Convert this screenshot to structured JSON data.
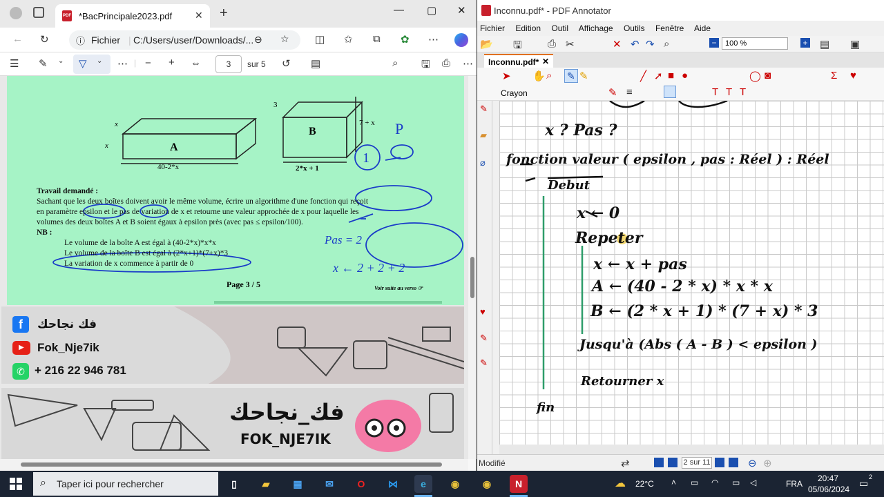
{
  "edge": {
    "tab_title": "*BacPrincipale2023.pdf",
    "tab_close": "✕",
    "new_tab": "+",
    "win_min": "—",
    "win_max": "▢",
    "win_close": "✕",
    "address_label": "Fichier",
    "address_url": "C:/Users/user/Downloads/...",
    "pdf_page": "3",
    "pdf_page_total": "sur 5",
    "document": {
      "box_a_label": "A",
      "box_b_label": "B",
      "box_a_dim": "40-2*x",
      "box_a_x1": "x",
      "box_a_x2": "x",
      "box_b_3": "3",
      "box_b_dim": "2*x + 1",
      "box_b_height": "7 + x",
      "task_title": "Travail demandé :",
      "task_line1": "Sachant que les deux boîtes doivent avoir le même volume, écrire un algorithme d'une fonction qui reçoit",
      "task_line2": "en paramètre epsilon et le pas de variation de x et retourne une valeur approchée de x pour laquelle les",
      "task_line3": "volumes des deux boîtes A et B soient égaux à epsilon près (avec pas ≤ epsilon/100).",
      "nb": "NB :",
      "bullet1": "Le volume de la boîte A est égal à (40-2*x)*x*x",
      "bullet2": "Le volume de la boîte B est égal à (2*x+1)*(7+x)*3",
      "bullet3": "La variation de x commence à partir de 0",
      "page": "Page 3 / 5",
      "suite": "Voir suite au verso ☞",
      "hand_pas": "Pas = 2",
      "hand_x": "x ← 2 + 2 + 2",
      "hand_1": "1",
      "hand_p": "P"
    },
    "banner": {
      "facebook": "فك نجاحك",
      "youtube": "Fok_Nje7ik",
      "whatsapp": "+ 216 22 946 781",
      "arabic_logo": "فك_نجاحك",
      "latin_logo": "FOK_NJE7IK"
    }
  },
  "annotator": {
    "title": "Inconnu.pdf* - PDF Annotator",
    "menu": [
      "Fichier",
      "Edition",
      "Outil",
      "Affichage",
      "Outils",
      "Fenêtre",
      "Aide"
    ],
    "zoom": "100 %",
    "doc_tab": "Inconnu.pdf*",
    "tool_name": "Crayon",
    "status": "Modifié",
    "page_info": "2 sur 11",
    "handwriting": {
      "l1": "x ? Pas ?",
      "l2": "fonction valeur ( epsilon , pas : Réel ) : Réel",
      "l3": "Debut",
      "l4": "x ← 0",
      "l5": "Repeter",
      "l6": "x ← x + pas",
      "l7": "A ← (40 - 2 * x) * x * x",
      "l8": "B ← (2 * x + 1) * (7 + x) * 3",
      "l9": "Jusqu'à (Abs ( A - B ) < epsilon )",
      "l10": "Retourner x",
      "l11": "fin"
    }
  },
  "taskbar": {
    "search_placeholder": "Taper ici pour rechercher",
    "temperature": "22°C",
    "lang": "FRA",
    "time": "20:47",
    "date": "05/06/2024",
    "notif_count": "2"
  }
}
